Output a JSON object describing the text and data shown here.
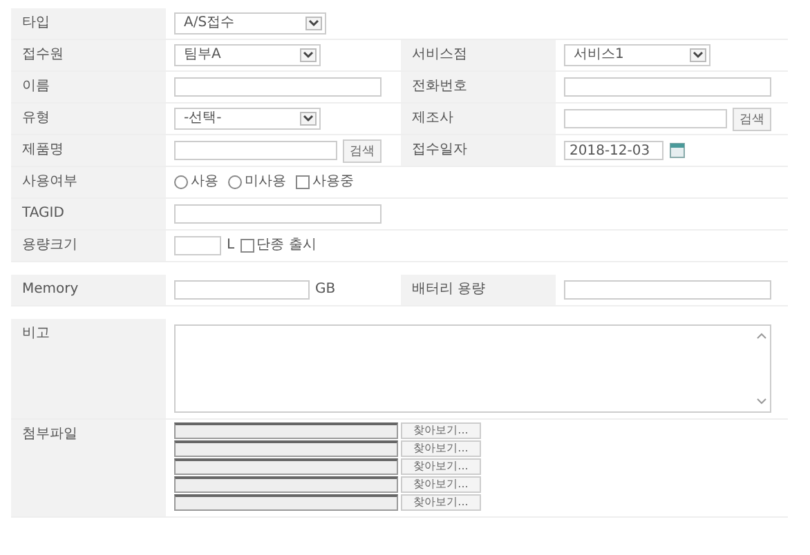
{
  "sections": [
    {
      "rows": [
        {
          "cells": [
            {
              "label": "타입",
              "field": {
                "kind": "select",
                "value": "A/S접수"
              }
            }
          ]
        },
        {
          "cells": [
            {
              "label": "접수원",
              "field": {
                "kind": "select",
                "value": "팀부A"
              }
            },
            {
              "label": "서비스점",
              "field": {
                "kind": "select",
                "value": "서비스1"
              }
            }
          ]
        },
        {
          "cells": [
            {
              "label": "이름",
              "field": {
                "kind": "text"
              }
            },
            {
              "label": "전화번호",
              "field": {
                "kind": "text"
              }
            }
          ]
        },
        {
          "cells": [
            {
              "label": "유형",
              "field": {
                "kind": "select",
                "value": "-선택-"
              }
            },
            {
              "label": "제조사",
              "field": {
                "kind": "search",
                "button": "검색"
              }
            }
          ]
        },
        {
          "cells": [
            {
              "label": "제품명",
              "field": {
                "kind": "search",
                "button": "검색"
              }
            },
            {
              "label": "접수일자",
              "field": {
                "kind": "date",
                "value": "2018-12-03"
              }
            }
          ]
        },
        {
          "cells": [
            {
              "label": "사용여부",
              "field": {
                "kind": "choices",
                "options": [
                  {
                    "kind": "radio",
                    "label": "사용",
                    "checked": false
                  },
                  {
                    "kind": "radio",
                    "label": "미사용",
                    "checked": false
                  },
                  {
                    "kind": "checkbox",
                    "label": "사용중",
                    "checked": false
                  }
                ]
              }
            }
          ]
        },
        {
          "cells": [
            {
              "label": "TAGID",
              "field": {
                "kind": "text"
              }
            }
          ]
        },
        {
          "cells": [
            {
              "label": "용량크기",
              "field": {
                "kind": "unit",
                "unit": "L",
                "options": [
                  {
                    "kind": "checkbox",
                    "label": "단종 출시",
                    "checked": false
                  }
                ]
              }
            }
          ]
        }
      ]
    },
    {
      "rows": [
        {
          "cells": [
            {
              "label": "Memory",
              "field": {
                "kind": "unit",
                "unit": "GB"
              }
            },
            {
              "label": "배터리 용량",
              "field": {
                "kind": "text"
              }
            }
          ]
        }
      ]
    },
    {
      "rows": [
        {
          "cells": [
            {
              "label": "비고",
              "field": {
                "kind": "textarea"
              }
            }
          ]
        },
        {
          "cells": [
            {
              "label": "첨부파일",
              "field": {
                "kind": "files",
                "buttons": [
                  "찾아보기...",
                  "찾아보기...",
                  "찾아보기...",
                  "찾아보기...",
                  "찾아보기..."
                ]
              }
            }
          ]
        }
      ]
    }
  ]
}
